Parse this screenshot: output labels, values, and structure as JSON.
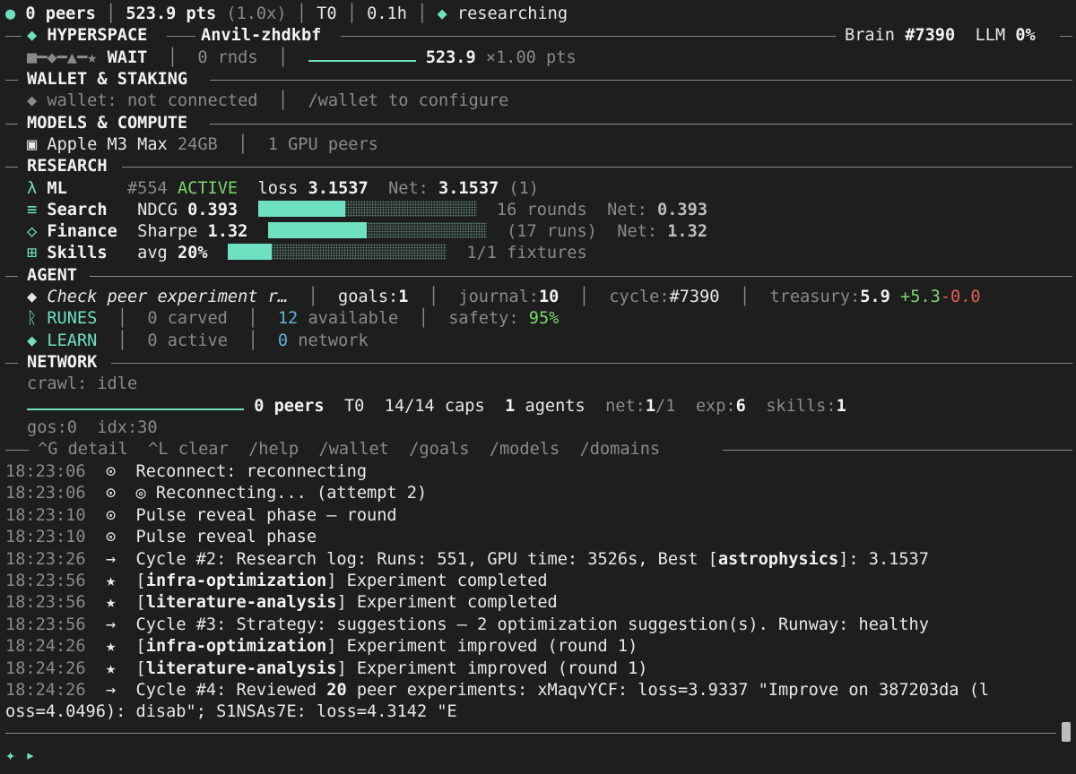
{
  "status": {
    "dot": "●",
    "peers": "0 peers",
    "pts": "523.9 pts",
    "multiplier": "(1.0x)",
    "tier": "T0",
    "hours": "0.1h",
    "state_icon": "◆",
    "state": "researching"
  },
  "header": {
    "icon": "◆",
    "app": "HYPERSPACE",
    "node": "Anvil-zhdkbf",
    "brain_label": "Brain",
    "brain": "#7390",
    "llm_label": "LLM",
    "llm": "0%"
  },
  "pulse": {
    "glyph": "■━◆━▲━★",
    "state": "WAIT",
    "rounds": "0 rnds",
    "pts": "523.9",
    "mult": "×1.00 pts"
  },
  "wallet": {
    "title": "WALLET & STAKING",
    "status": "◆ wallet: not connected",
    "hint": "/wallet to configure"
  },
  "models": {
    "title": "MODELS & COMPUTE",
    "chip": "▣ Apple M3 Max",
    "mem": "24GB",
    "gpu": "1 GPU peers"
  },
  "research": {
    "title": "RESEARCH",
    "ml": {
      "icon": "λ",
      "name": "ML",
      "id": "#554",
      "status": "ACTIVE",
      "loss_label": "loss",
      "loss": "3.1537",
      "net_label": "Net:",
      "net": "3.1537",
      "count": "(1)"
    },
    "search": {
      "icon": "≡",
      "name": "Search",
      "metric": "NDCG",
      "value": "0.393",
      "progress": 0.4,
      "tail": "16 rounds",
      "net_label": "Net:",
      "net": "0.393"
    },
    "finance": {
      "icon": "◇",
      "name": "Finance",
      "metric": "Sharpe",
      "value": "1.32",
      "progress": 0.45,
      "tail": "(17 runs)",
      "net_label": "Net:",
      "net": "1.32"
    },
    "skills": {
      "icon": "⊞",
      "name": "Skills",
      "metric": "avg",
      "value": "20%",
      "progress": 0.2,
      "tail": "1/1 fixtures"
    }
  },
  "agent": {
    "title": "AGENT",
    "task": "◆ Check peer experiment r…",
    "goals_label": "goals:",
    "goals": "1",
    "journal_label": "journal:",
    "journal": "10",
    "cycle_label": "cycle:",
    "cycle": "#7390",
    "treasury_label": "treasury:",
    "treasury": "5.9",
    "treasury_up": "+5.3",
    "treasury_down": "-0.0",
    "runes": "ᚱ RUNES",
    "carved": "0 carved",
    "available_n": "12",
    "available": "available",
    "safety_label": "safety:",
    "safety": "95%",
    "learn": "◆ LEARN",
    "active": "0 active",
    "network_n": "0",
    "network": "network"
  },
  "network": {
    "title": "NETWORK",
    "crawl": "crawl: idle",
    "peers": "0 peers",
    "tier": "T0",
    "caps": "14/14 caps",
    "agents_n": "1",
    "agents": "agents",
    "net_label": "net:",
    "net_a": "1",
    "net_b": "/1",
    "exp_label": "exp:",
    "exp": "6",
    "skills_label": "skills:",
    "skills": "1",
    "gos": "gos:0",
    "idx": "idx:30"
  },
  "shortcuts": [
    "^G detail",
    "^L clear",
    "/help",
    "/wallet",
    "/goals",
    "/models",
    "/domains"
  ],
  "log": [
    {
      "time": "18:23:06",
      "icon": "⊙",
      "text": "Reconnect: reconnecting"
    },
    {
      "time": "18:23:06",
      "icon": "⊙",
      "text": "◎ Reconnecting... (attempt 2)"
    },
    {
      "time": "18:23:10",
      "icon": "⊙",
      "text": "Pulse reveal phase — round"
    },
    {
      "time": "18:23:10",
      "icon": "⊙",
      "text": "Pulse reveal phase"
    },
    {
      "time": "18:23:26",
      "icon": "→",
      "pre": "Cycle #2: Research log: Runs: 551, GPU time: 3526s, Best [",
      "bold": "astrophysics",
      "post": "]: 3.1537"
    },
    {
      "time": "18:23:56",
      "icon": "★",
      "pre": "[",
      "bold": "infra-optimization",
      "post": "] Experiment completed"
    },
    {
      "time": "18:23:56",
      "icon": "★",
      "pre": "[",
      "bold": "literature-analysis",
      "post": "] Experiment completed"
    },
    {
      "time": "18:23:56",
      "icon": "→",
      "text": "Cycle #3: Strategy: suggestions — 2 optimization suggestion(s). Runway: healthy"
    },
    {
      "time": "18:24:26",
      "icon": "★",
      "pre": "[",
      "bold": "infra-optimization",
      "post": "] Experiment improved (round 1)"
    },
    {
      "time": "18:24:26",
      "icon": "★",
      "pre": "[",
      "bold": "literature-analysis",
      "post": "] Experiment improved (round 1)"
    },
    {
      "time": "18:24:26",
      "icon": "→",
      "pre": "Cycle #4: Reviewed ",
      "bold": "20",
      "post": " peer experiments: xMaqvYCF: loss=3.9337 \"Improve on 387203da (l",
      "cont": "oss=4.0496): disab\"; S1NSAs7E: loss=4.3142 \"E"
    }
  ],
  "prompt": {
    "icon": "✦",
    "caret": "▸"
  }
}
